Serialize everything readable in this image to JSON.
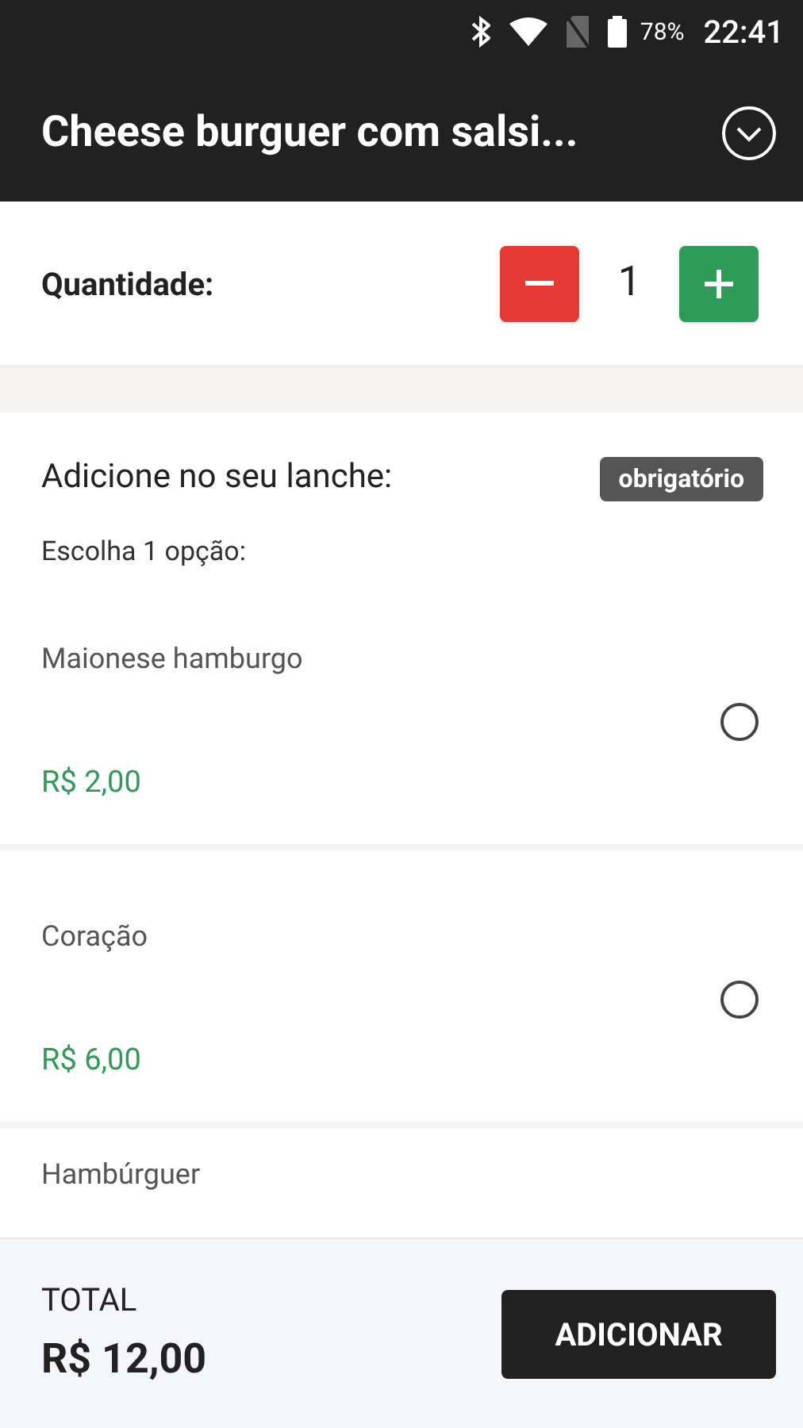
{
  "status_bar": {
    "battery": "78%",
    "time": "22:41"
  },
  "header": {
    "title": "Cheese burguer com salsi..."
  },
  "quantity": {
    "label": "Quantidade:",
    "value": "1"
  },
  "section": {
    "title": "Adicione no seu lanche:",
    "badge": "obrigatório",
    "hint": "Escolha 1 opção:",
    "options": [
      {
        "name": "Maionese hamburgo",
        "price": "R$ 2,00",
        "selected": false
      },
      {
        "name": "Coração",
        "price": "R$ 6,00",
        "selected": false
      },
      {
        "name": "Hambúrguer"
      }
    ]
  },
  "footer": {
    "total_label": "TOTAL",
    "total": "R$ 12,00",
    "button": "ADICIONAR"
  }
}
